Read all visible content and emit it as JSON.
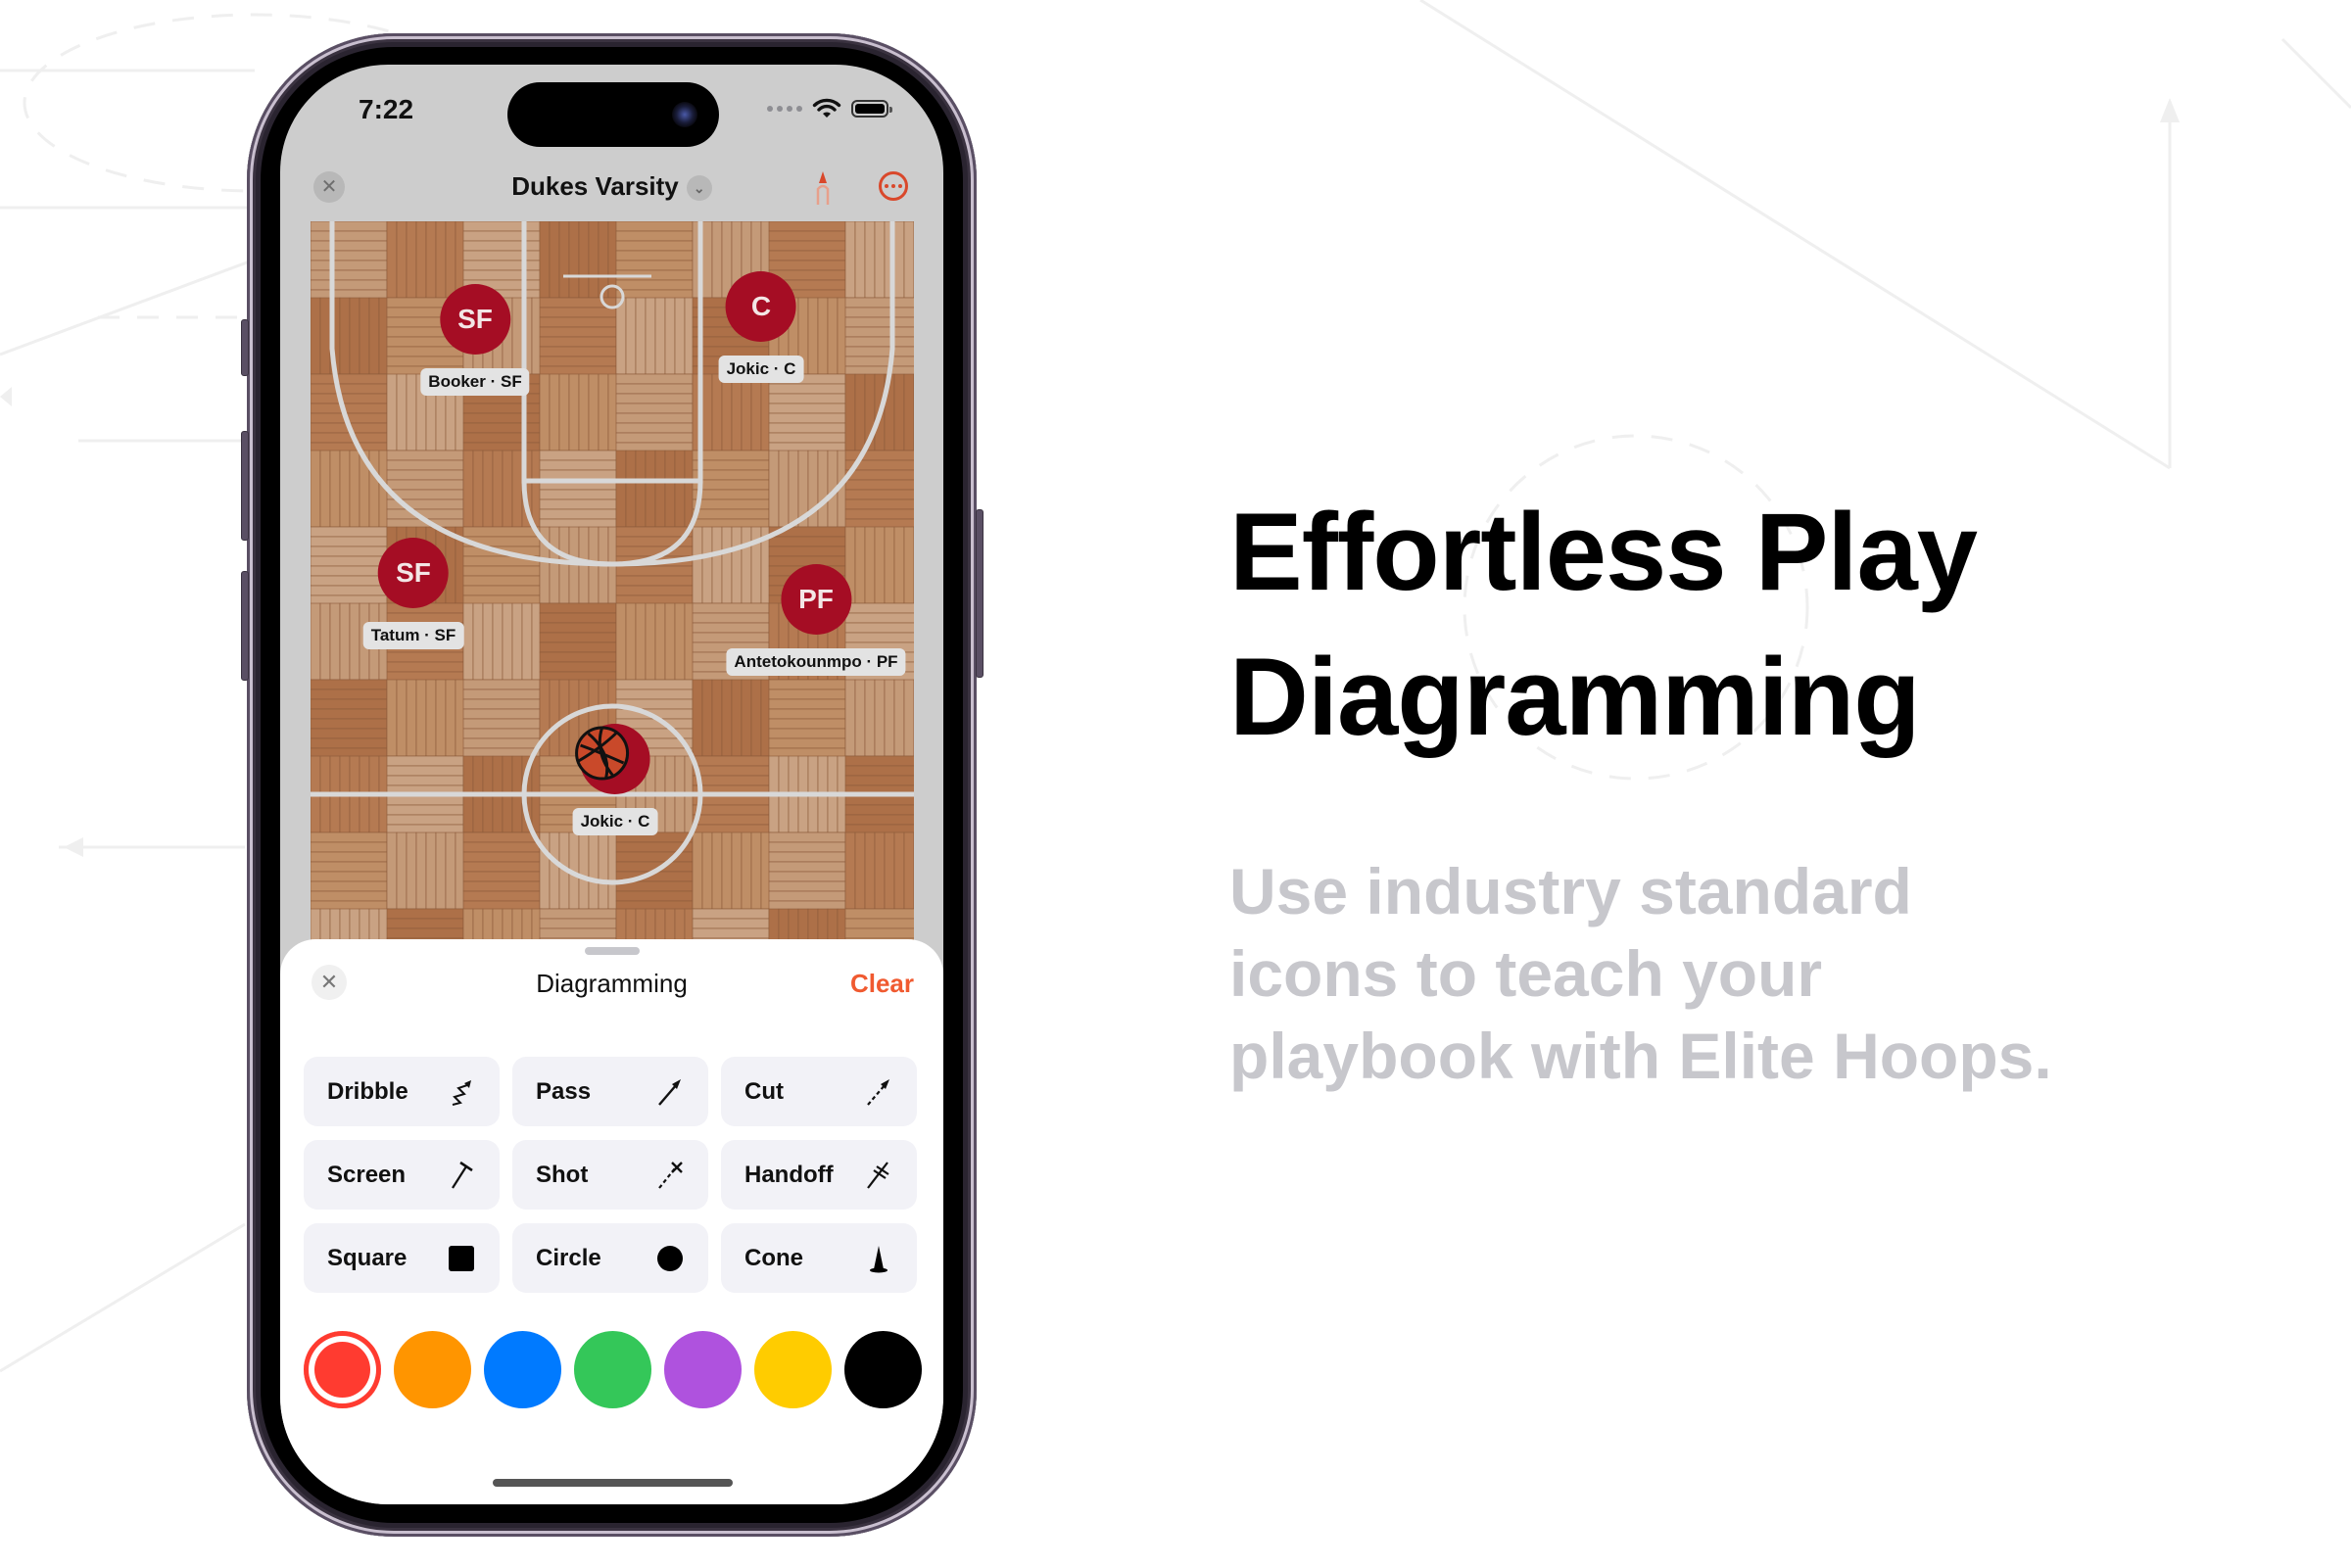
{
  "status_bar": {
    "time": "7:22"
  },
  "nav": {
    "title": "Dukes Varsity",
    "close_icon": "xmark-icon",
    "dropdown_icon": "chevron-down-icon",
    "pen_icon": "marker-icon",
    "more_icon": "ellipsis-circle-icon"
  },
  "court": {
    "players": [
      {
        "token": "SF",
        "label": "Booker · SF",
        "has_ball": false
      },
      {
        "token": "C",
        "label": "Jokic · C",
        "has_ball": false
      },
      {
        "token": "SF",
        "label": "Tatum · SF",
        "has_ball": false
      },
      {
        "token": "PF",
        "label": "Antetokounmpo · PF",
        "has_ball": false
      },
      {
        "token": "",
        "label": "Jokic · C",
        "has_ball": true
      }
    ]
  },
  "sheet": {
    "title": "Diagramming",
    "clear_label": "Clear",
    "tools": [
      {
        "label": "Dribble",
        "icon": "dribble-arrow-icon"
      },
      {
        "label": "Pass",
        "icon": "pass-arrow-icon"
      },
      {
        "label": "Cut",
        "icon": "cut-dashed-arrow-icon"
      },
      {
        "label": "Screen",
        "icon": "screen-icon"
      },
      {
        "label": "Shot",
        "icon": "shot-icon"
      },
      {
        "label": "Handoff",
        "icon": "handoff-icon"
      },
      {
        "label": "Square",
        "icon": "square-icon"
      },
      {
        "label": "Circle",
        "icon": "circle-icon"
      },
      {
        "label": "Cone",
        "icon": "cone-icon"
      }
    ],
    "colors": [
      {
        "name": "red",
        "hex": "#ff3b30",
        "selected": true
      },
      {
        "name": "orange",
        "hex": "#ff9500",
        "selected": false
      },
      {
        "name": "blue",
        "hex": "#007aff",
        "selected": false
      },
      {
        "name": "green",
        "hex": "#34c759",
        "selected": false
      },
      {
        "name": "purple",
        "hex": "#af52de",
        "selected": false
      },
      {
        "name": "yellow",
        "hex": "#ffcc00",
        "selected": false
      },
      {
        "name": "black",
        "hex": "#000000",
        "selected": false
      }
    ]
  },
  "marketing": {
    "headline_line1": "Effortless Play",
    "headline_line2": "Diagramming",
    "subhead_line1": "Use industry standard",
    "subhead_line2": "icons to teach your",
    "subhead_line3": "playbook with Elite Hoops."
  },
  "colors": {
    "accent": "#f05a30",
    "player": "#a50d24",
    "court": "#b77a52"
  }
}
